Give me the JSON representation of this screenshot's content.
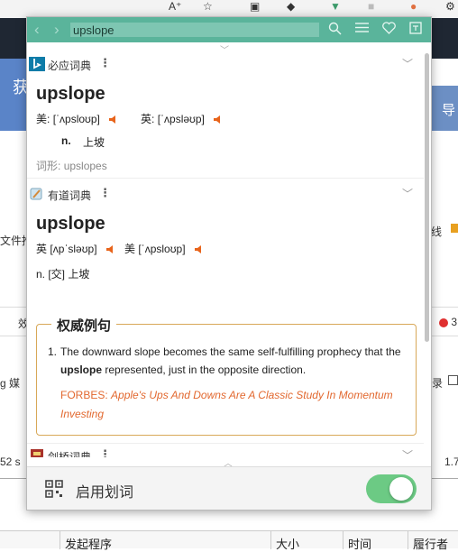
{
  "background": {
    "text_left_1": "获",
    "text_left_2": "文件推",
    "text_left_3": "效",
    "text_left_4": "g  媒",
    "text_left_5": "52 s",
    "text_right_1": "导",
    "text_right_2": "线",
    "text_right_3": "3",
    "text_right_4": "录",
    "text_right_5": "1.7",
    "columns": [
      "发起程序",
      "大小",
      "时间",
      "履行者"
    ]
  },
  "popup": {
    "search_value": "upslope",
    "dicts": {
      "bing": {
        "name": "必应词典",
        "word": "upslope",
        "us_label": "美:",
        "us_phon": "[ˈʌpsloʊp]",
        "uk_label": "英:",
        "uk_phon": "[ˈʌpsləʊp]",
        "pos": "n.",
        "def": "上坡",
        "forms_label": "词形:",
        "forms": "upslopes"
      },
      "youdao": {
        "name": "有道词典",
        "word": "upslope",
        "uk_label": "英",
        "uk_phon": "[ʌpˈsləʊp]",
        "us_label": "美",
        "us_phon": "[ˈʌpsloʊp]",
        "def": "n. [交] 上坡",
        "example_title": "权威例句",
        "example_num": "1.",
        "example_pre": "The downward slope becomes the same self-fulfilling prophecy that the ",
        "example_bold": "upslope",
        "example_post": " represented, just in the opposite direction.",
        "source_name": "FORBES:",
        "source_title": "Apple's Ups And Downs Are A Classic Study In Momentum Investing"
      },
      "cambridge": {
        "name": "剑桥词典"
      }
    },
    "bottom_label": "启用划词",
    "toggle_on": true
  },
  "colors": {
    "accent": "#5ab49b",
    "speaker": "#e8641b",
    "source": "#e2682f",
    "toggle": "#6cca84"
  }
}
